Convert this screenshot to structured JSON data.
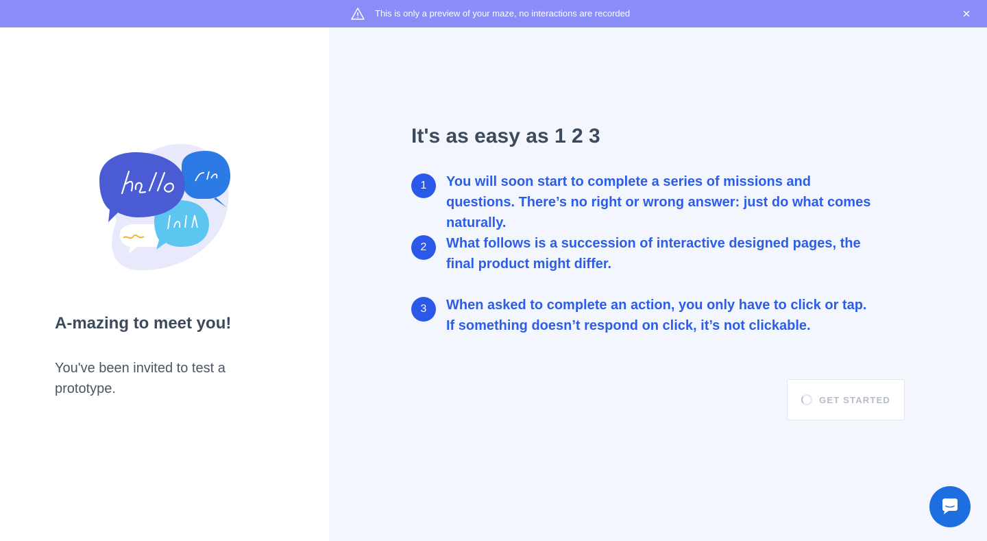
{
  "banner": {
    "text": "This is only a preview of your maze, no interactions are recorded",
    "icon": "warning-icon",
    "close_icon": "close-icon"
  },
  "left": {
    "illustration_icon": "speech-bubbles-illustration",
    "title": "A-mazing to meet you!",
    "subtitle": "You've been invited to test a prototype."
  },
  "right": {
    "title": "It's as easy as 1 2 3",
    "steps": [
      {
        "number": "1",
        "text": "You will soon start to complete a series of missions and questions. There’s no right or wrong answer: just do what comes naturally."
      },
      {
        "number": "2",
        "text": "What follows is a succession of interactive designed pages, the final product might differ."
      },
      {
        "number": "3",
        "text": "When asked to complete an action, you only have to click or tap. If something doesn’t respond on click, it’s not clickable."
      }
    ],
    "start_button": "GET STARTED"
  },
  "colors": {
    "banner": "#8a8cf7",
    "accent": "#2c5de6",
    "chat": "#1d6fe0"
  },
  "chat": {
    "icon": "chat-icon"
  }
}
